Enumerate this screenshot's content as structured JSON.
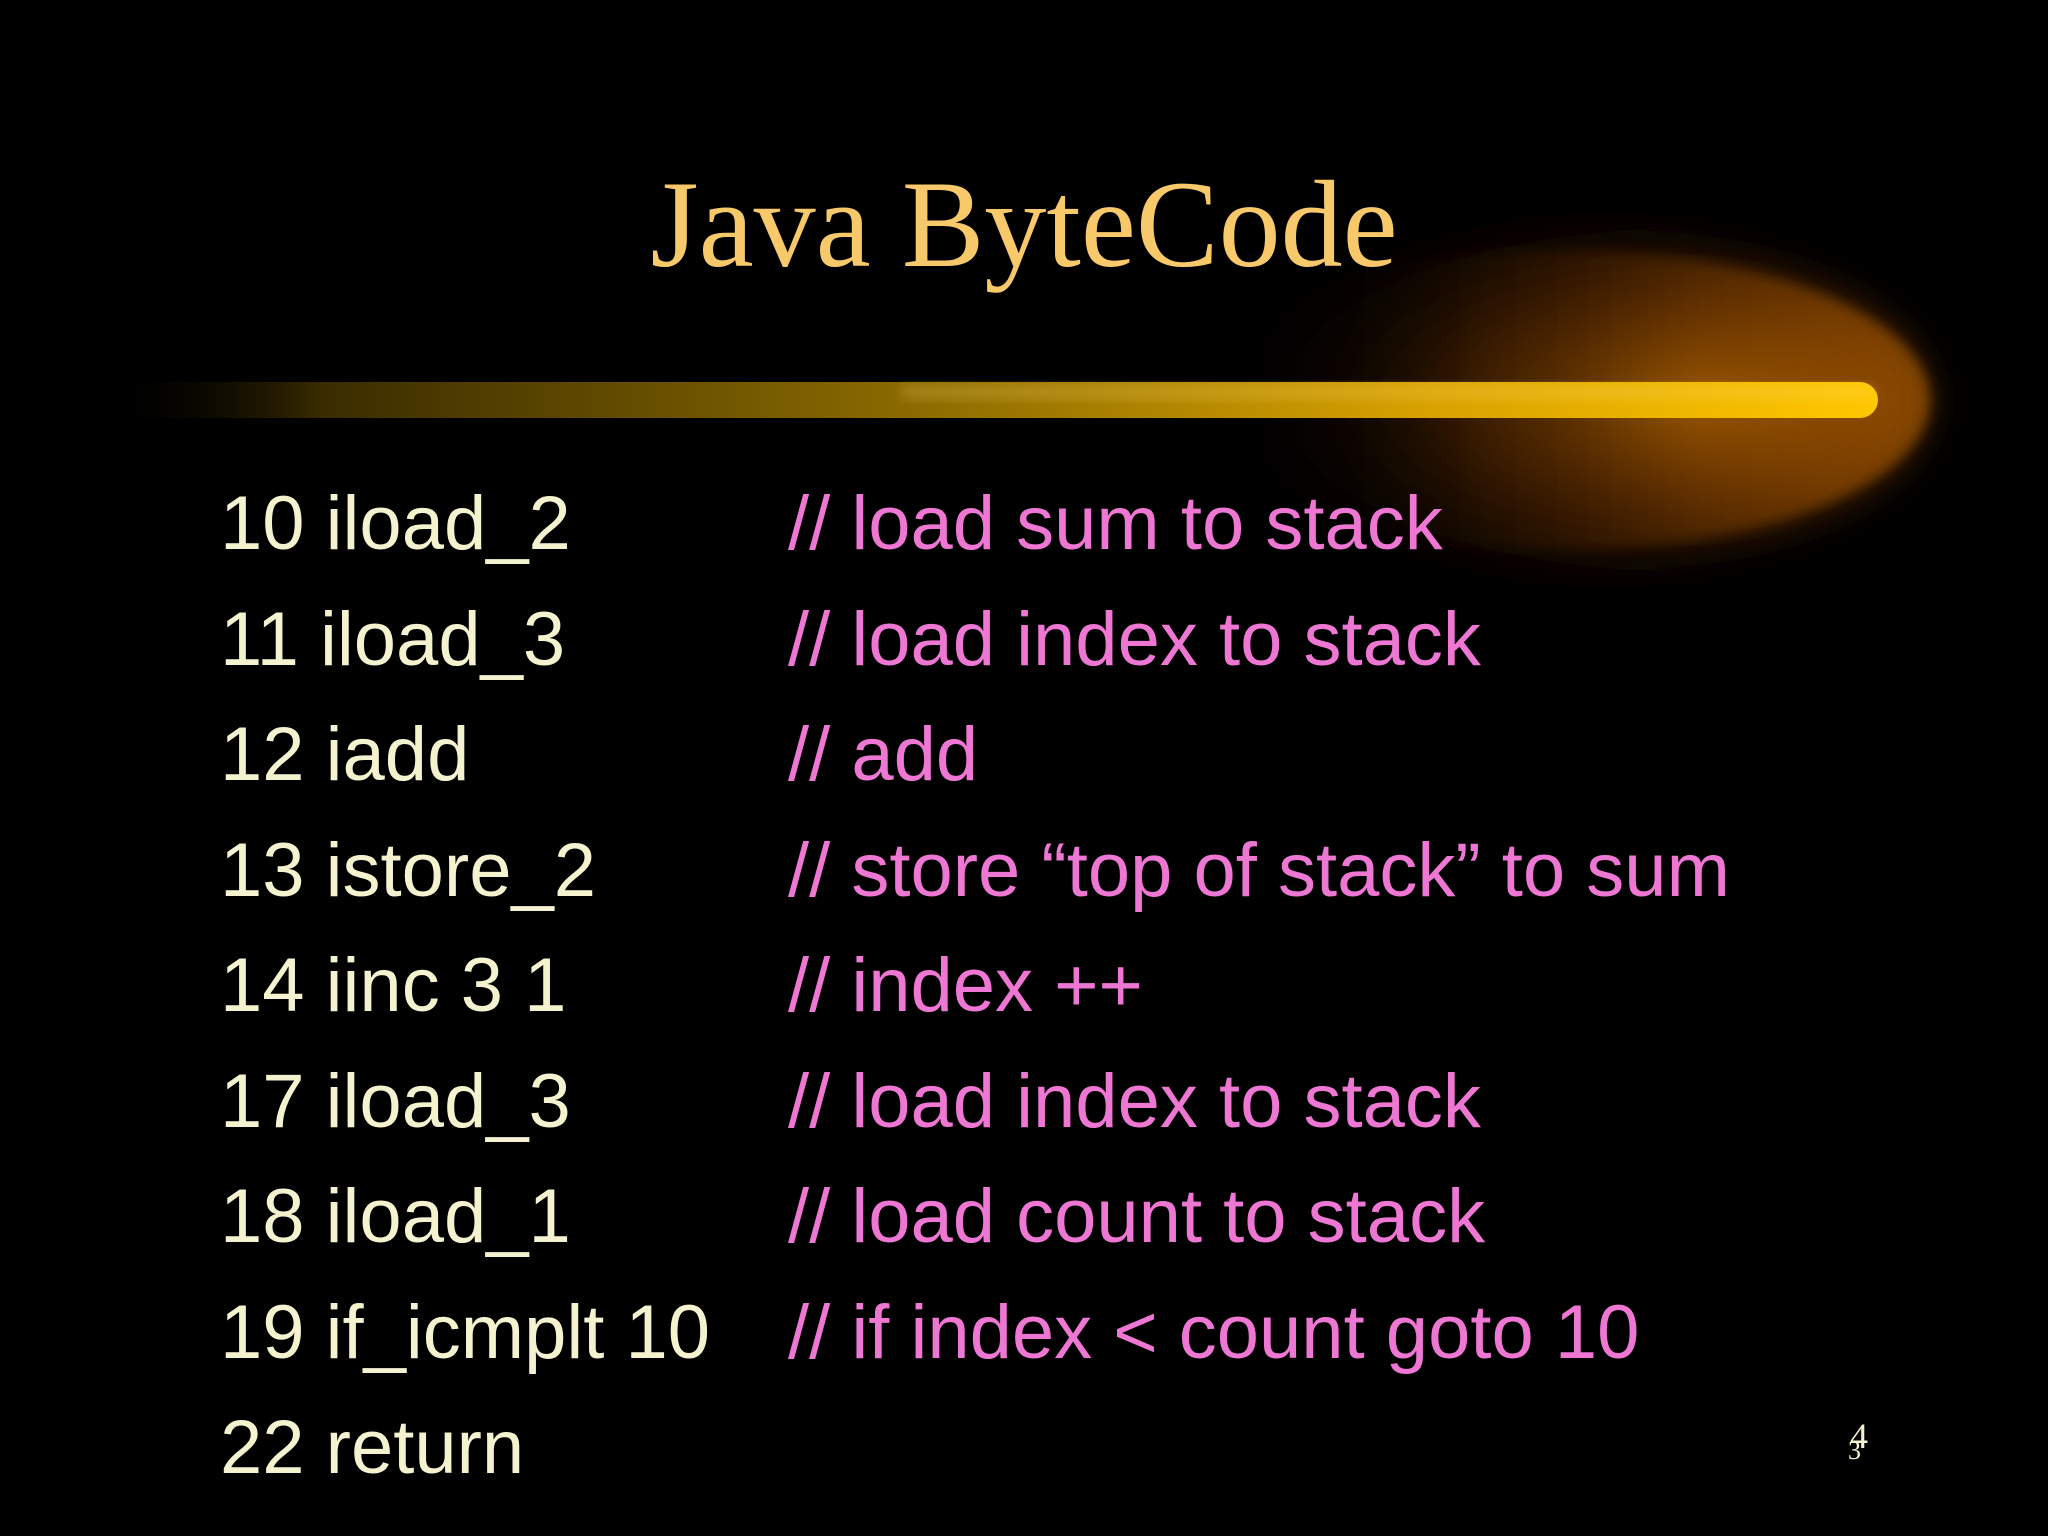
{
  "slide": {
    "title": "Java ByteCode",
    "colors": {
      "background": "#000000",
      "title": "#f7c96a",
      "code": "#f5f3cf",
      "comment": "#ee77d4",
      "accent": "#f0b800"
    },
    "lines": [
      {
        "instruction": "10 iload_2",
        "comment": "// load sum to stack"
      },
      {
        "instruction": "11 iload_3",
        "comment": "// load index to stack"
      },
      {
        "instruction": "12 iadd",
        "comment": "// add"
      },
      {
        "instruction": "13 istore_2",
        "comment": "// store “top of stack” to sum"
      },
      {
        "instruction": "14 iinc 3 1",
        "comment": "// index ++"
      },
      {
        "instruction": "17 iload_3",
        "comment": "// load index to stack"
      },
      {
        "instruction": "18 iload_1",
        "comment": "// load count to stack"
      },
      {
        "instruction": "19 if_icmplt 10",
        "comment": "// if index < count goto 10"
      },
      {
        "instruction": "22 return",
        "comment": ""
      }
    ],
    "page_number": {
      "upper": "4",
      "lower": "3"
    }
  }
}
